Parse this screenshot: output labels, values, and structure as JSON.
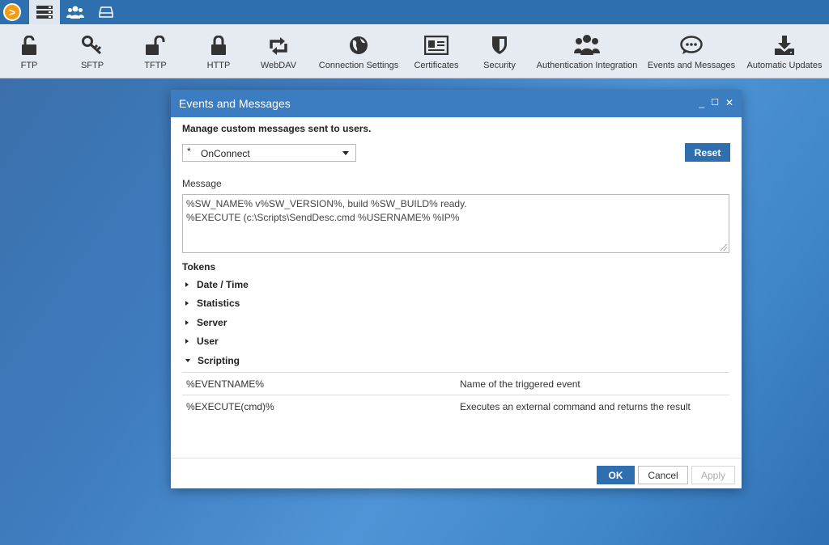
{
  "topstrip": {
    "tabs": [
      {
        "icon": "server-list-icon",
        "active": true
      },
      {
        "icon": "users-icon",
        "active": false
      },
      {
        "icon": "drive-icon",
        "active": false
      }
    ]
  },
  "toolbar": {
    "items": [
      {
        "label": "FTP",
        "icon": "lock-open-icon"
      },
      {
        "label": "SFTP",
        "icon": "key-icon"
      },
      {
        "label": "TFTP",
        "icon": "lock-open-icon"
      },
      {
        "label": "HTTP",
        "icon": "lock-icon"
      },
      {
        "label": "WebDAV",
        "icon": "sync-icon"
      },
      {
        "label": "Connection Settings",
        "icon": "globe-icon"
      },
      {
        "label": "Certificates",
        "icon": "id-card-icon"
      },
      {
        "label": "Security",
        "icon": "shield-icon"
      },
      {
        "label": "Authentication Integration",
        "icon": "users-icon"
      },
      {
        "label": "Events and Messages",
        "icon": "chat-icon"
      },
      {
        "label": "Automatic Updates",
        "icon": "download-icon"
      }
    ]
  },
  "dialog": {
    "title": "Events and Messages",
    "controls": {
      "minimize": "_",
      "maximize": "☐",
      "close": "✕"
    },
    "subtitle": "Manage custom messages sent to users.",
    "event_select": {
      "marker": "*",
      "value": "OnConnect"
    },
    "reset_label": "Reset",
    "message_label": "Message",
    "message_lines": [
      "%SW_NAME% v%SW_VERSION%, build %SW_BUILD% ready.",
      "%EXECUTE (c:\\Scripts\\SendDesc.cmd %USERNAME% %IP%"
    ],
    "tokens_label": "Tokens",
    "token_groups": [
      {
        "label": "Date / Time",
        "expanded": false
      },
      {
        "label": "Statistics",
        "expanded": false
      },
      {
        "label": "Server",
        "expanded": false
      },
      {
        "label": "User",
        "expanded": false
      },
      {
        "label": "Scripting",
        "expanded": true
      }
    ],
    "token_rows": [
      {
        "token": "%EVENTNAME%",
        "description": "Name of the triggered event"
      },
      {
        "token": "%EXECUTE(cmd)%",
        "description": "Executes an external command and returns the result"
      }
    ],
    "footer": {
      "ok": "OK",
      "cancel": "Cancel",
      "apply": "Apply"
    }
  }
}
